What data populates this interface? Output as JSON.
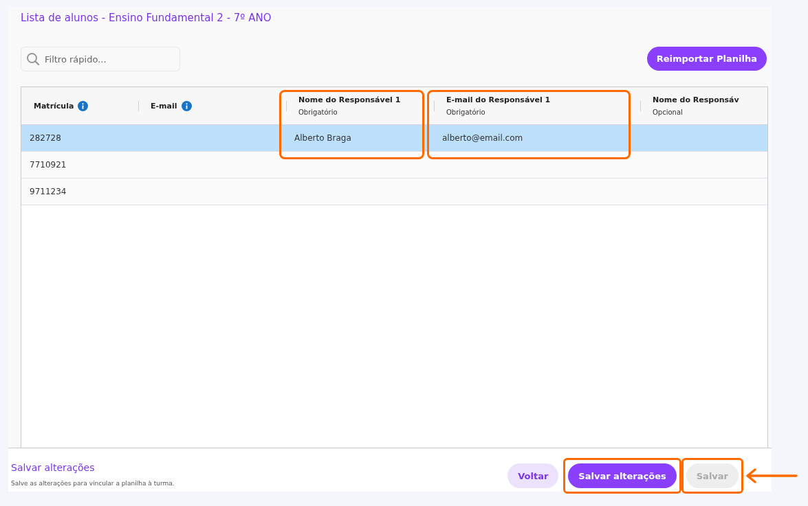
{
  "title": "Lista de alunos - Ensino Fundamental 2 - 7º ANO",
  "search": {
    "placeholder": "Filtro rápido..."
  },
  "reimport_button": "Reimportar Planilha",
  "table": {
    "columns": [
      {
        "label": "Matrícula",
        "info": true,
        "highlighted": false
      },
      {
        "label": "E-mail",
        "info": true,
        "highlighted": false
      },
      {
        "label": "Nome do Responsável 1",
        "info": false,
        "note": "Obrigatório",
        "highlighted": true
      },
      {
        "label": "E-mail do Responsável 1",
        "info": false,
        "note": "Obrigatório",
        "highlighted": true
      },
      {
        "label": "Nome do Responsáv",
        "info": false,
        "note": "Opcional",
        "highlighted": false
      }
    ],
    "rows": [
      {
        "selected": true,
        "cells": [
          "282728",
          "",
          "Alberto Braga",
          "alberto@email.com",
          ""
        ]
      },
      {
        "selected": false,
        "cells": [
          "7710921",
          "",
          "",
          "",
          ""
        ]
      },
      {
        "selected": false,
        "cells": [
          "9711234",
          "",
          "",
          "",
          ""
        ]
      }
    ]
  },
  "footer": {
    "title": "Salvar alterações",
    "description": "Salve as alterações para vincular a planilha à turma.",
    "buttons": [
      {
        "label": "Voltar",
        "kind": "secondary",
        "disabled": false,
        "highlighted": false,
        "arrow": false
      },
      {
        "label": "Salvar alterações",
        "kind": "primary",
        "disabled": false,
        "highlighted": true,
        "arrow": false
      },
      {
        "label": "Salvar",
        "kind": "primary",
        "disabled": true,
        "highlighted": true,
        "arrow": true
      }
    ]
  }
}
